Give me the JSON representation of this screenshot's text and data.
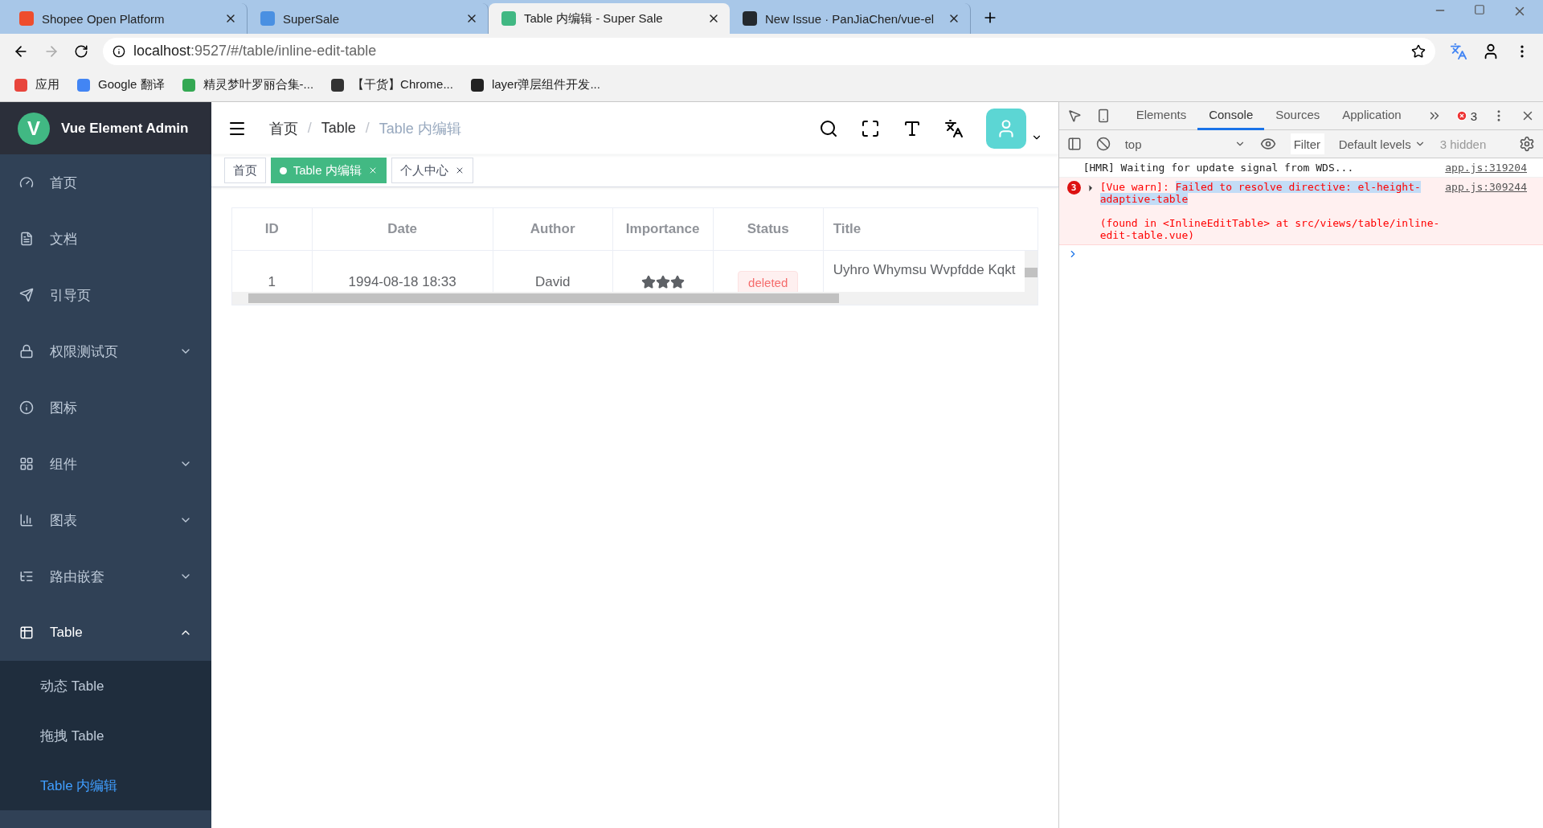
{
  "browser": {
    "tabs": [
      {
        "title": "Shopee Open Platform",
        "selected": false,
        "color": "#ee4d2d"
      },
      {
        "title": "SuperSale",
        "selected": false,
        "color": "#4a90e2"
      },
      {
        "title": "Table 内编辑 - Super Sale",
        "selected": true,
        "color": "#41b883"
      },
      {
        "title": "New Issue · PanJiaChen/vue-el",
        "selected": false,
        "color": "#24292e"
      }
    ],
    "address": {
      "host": "localhost",
      "rest": ":9527/#/table/inline-edit-table"
    },
    "bookmarks": [
      {
        "label": "应用",
        "color": "#e8453c"
      },
      {
        "label": "Google 翻译",
        "color": "#4285f4"
      },
      {
        "label": "精灵梦叶罗丽合集-...",
        "color": "#34a853"
      },
      {
        "label": "【干货】Chrome...",
        "color": "#333333"
      },
      {
        "label": "layer弹层组件开发...",
        "color": "#222222"
      }
    ]
  },
  "sidebar": {
    "logo_letter": "V",
    "title": "Vue Element Admin",
    "items": [
      {
        "label": "首页",
        "expandable": false
      },
      {
        "label": "文档",
        "expandable": false
      },
      {
        "label": "引导页",
        "expandable": false
      },
      {
        "label": "权限测试页",
        "expandable": true,
        "expanded": false
      },
      {
        "label": "图标",
        "expandable": false
      },
      {
        "label": "组件",
        "expandable": true,
        "expanded": false
      },
      {
        "label": "图表",
        "expandable": true,
        "expanded": false
      },
      {
        "label": "路由嵌套",
        "expandable": true,
        "expanded": false
      },
      {
        "label": "Table",
        "expandable": true,
        "expanded": true,
        "children": [
          {
            "label": "动态 Table",
            "selected": false
          },
          {
            "label": "拖拽 Table",
            "selected": false
          },
          {
            "label": "Table 内编辑",
            "selected": true
          }
        ]
      }
    ]
  },
  "navbar": {
    "separator": "/",
    "breadcrumb": [
      {
        "label": "首页",
        "current": false
      },
      {
        "label": "Table",
        "current": false
      },
      {
        "label": "Table 内编辑",
        "current": true
      }
    ]
  },
  "tags": [
    {
      "label": "首页",
      "selected": false,
      "closable": false
    },
    {
      "label": "Table 内编辑",
      "selected": true,
      "closable": true
    },
    {
      "label": "个人中心",
      "selected": false,
      "closable": true
    }
  ],
  "table": {
    "columns": [
      "ID",
      "Date",
      "Author",
      "Importance",
      "Status",
      "Title"
    ],
    "rows": [
      {
        "id": "1",
        "date": "1994-08-18 18:33",
        "author": "David",
        "stars": 3,
        "status": "deleted",
        "title": "Uyhro Whymsu Wvpfdde Kqkt"
      }
    ]
  },
  "devtools": {
    "tabs": [
      {
        "label": "Elements",
        "selected": false
      },
      {
        "label": "Console",
        "selected": true
      },
      {
        "label": "Sources",
        "selected": false
      },
      {
        "label": "Application",
        "selected": false
      }
    ],
    "error_count": "3",
    "context": "top",
    "filter_placeholder": "Filter",
    "levels": "Default levels",
    "hidden": "3 hidden",
    "messages": [
      {
        "kind": "log",
        "text": "[HMR] Waiting for update signal from WDS...",
        "source": "app.js:319204"
      },
      {
        "kind": "error",
        "count": "3",
        "prefix": "[Vue warn]: ",
        "highlight": "Failed to resolve directive: el-height-adaptive-table",
        "detail": "(found in <InlineEditTable> at src/views/table/inline-edit-table.vue)",
        "source": "app.js:309244"
      }
    ]
  }
}
